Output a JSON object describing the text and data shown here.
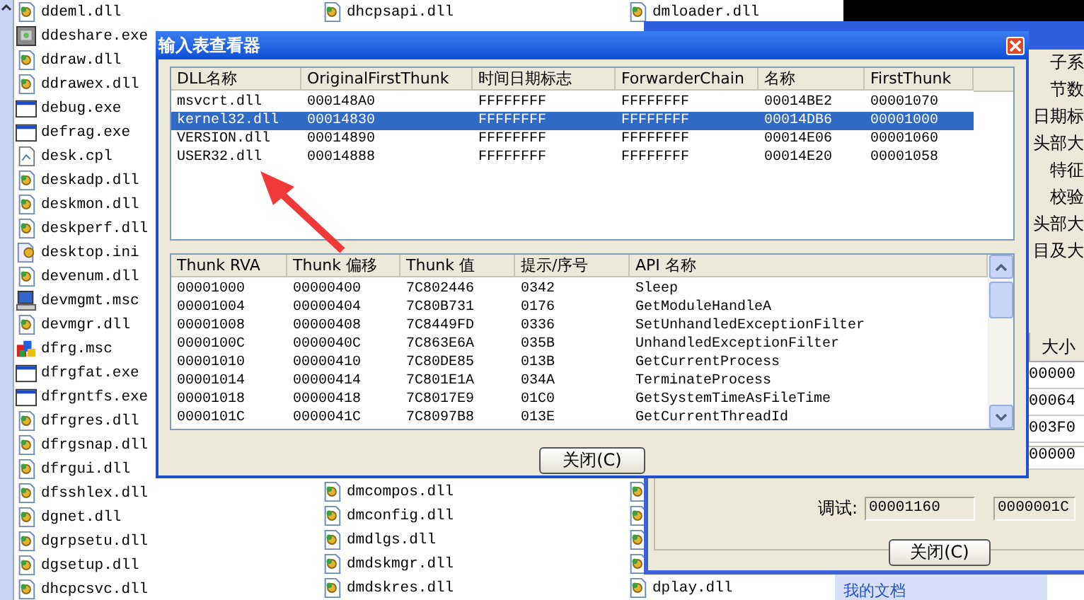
{
  "file_list": {
    "columns": [
      {
        "top_items": [
          {
            "name": "ddeml.dll",
            "kind": "dll"
          },
          {
            "name": "ddeshare.exe",
            "kind": "app"
          },
          {
            "name": "ddraw.dll",
            "kind": "dll"
          },
          {
            "name": "ddrawex.dll",
            "kind": "dll"
          },
          {
            "name": "debug.exe",
            "kind": "window"
          },
          {
            "name": "defrag.exe",
            "kind": "window"
          },
          {
            "name": "desk.cpl",
            "kind": "cpl"
          },
          {
            "name": "deskadp.dll",
            "kind": "dll"
          },
          {
            "name": "deskmon.dll",
            "kind": "dll"
          },
          {
            "name": "deskperf.dll",
            "kind": "dll"
          },
          {
            "name": "desktop.ini",
            "kind": "ini"
          },
          {
            "name": "devenum.dll",
            "kind": "dll"
          },
          {
            "name": "devmgmt.msc",
            "kind": "computer"
          },
          {
            "name": "devmgr.dll",
            "kind": "dll"
          },
          {
            "name": "dfrg.msc",
            "kind": "snapin"
          },
          {
            "name": "dfrgfat.exe",
            "kind": "window"
          },
          {
            "name": "dfrgntfs.exe",
            "kind": "window"
          },
          {
            "name": "dfrgres.dll",
            "kind": "dll"
          },
          {
            "name": "dfrgsnap.dll",
            "kind": "dll"
          },
          {
            "name": "dfrgui.dll",
            "kind": "dll"
          },
          {
            "name": "dfsshlex.dll",
            "kind": "dll"
          },
          {
            "name": "dgnet.dll",
            "kind": "dll"
          },
          {
            "name": "dgrpsetu.dll",
            "kind": "dll"
          },
          {
            "name": "dgsetup.dll",
            "kind": "dll"
          },
          {
            "name": "dhcpcsvc.dll",
            "kind": "dll"
          }
        ]
      },
      {
        "top_items": [
          {
            "name": "dhcpsapi.dll",
            "kind": "dll"
          }
        ],
        "bottom_items": [
          {
            "name": "dmcompos.dll",
            "kind": "dll"
          },
          {
            "name": "dmconfig.dll",
            "kind": "dll"
          },
          {
            "name": "dmdlgs.dll",
            "kind": "dll"
          },
          {
            "name": "dmdskmgr.dll",
            "kind": "dll"
          },
          {
            "name": "dmdskres.dll",
            "kind": "dll"
          }
        ]
      },
      {
        "top_items": [
          {
            "name": "dmloader.dll",
            "kind": "dll"
          }
        ],
        "bottom_items": [
          {
            "kind": "dll"
          },
          {
            "kind": "dll"
          },
          {
            "kind": "dll"
          },
          {
            "kind": "dll"
          },
          {
            "name": "dplay.dll",
            "kind": "dll"
          }
        ]
      }
    ]
  },
  "pe_window": {
    "field_labels": [
      "子系",
      "节数",
      "日期标",
      "头部大",
      "特征",
      "校验",
      "头部大",
      "目及大"
    ],
    "section_table": {
      "column": "大小",
      "values": [
        "00000",
        "00064",
        "003F0",
        "00000"
      ]
    },
    "debug_row": {
      "label": "调试:",
      "values": [
        "00001160",
        "0000001C"
      ]
    },
    "close_button": "关闭(C)"
  },
  "task_pane": {
    "link": "我的文档"
  },
  "dialog": {
    "title": "输入表查看器",
    "dll_table": {
      "columns": [
        "DLL名称",
        "OriginalFirstThunk",
        "时间日期标志",
        "ForwarderChain",
        "名称",
        "FirstThunk"
      ],
      "rows": [
        {
          "cells": [
            "msvcrt.dll",
            "000148A0",
            "FFFFFFFF",
            "FFFFFFFF",
            "00014BE2",
            "00001070"
          ],
          "selected": false
        },
        {
          "cells": [
            "kernel32.dll",
            "00014830",
            "FFFFFFFF",
            "FFFFFFFF",
            "00014DB6",
            "00001000"
          ],
          "selected": true
        },
        {
          "cells": [
            "VERSION.dll",
            "00014890",
            "FFFFFFFF",
            "FFFFFFFF",
            "00014E06",
            "00001060"
          ],
          "selected": false
        },
        {
          "cells": [
            "USER32.dll",
            "00014888",
            "FFFFFFFF",
            "FFFFFFFF",
            "00014E20",
            "00001058"
          ],
          "selected": false
        }
      ]
    },
    "thunk_table": {
      "columns": [
        "Thunk RVA",
        "Thunk 偏移",
        "Thunk 值",
        "提示/序号",
        "API 名称"
      ],
      "rows": [
        [
          "00001000",
          "00000400",
          "7C802446",
          "0342",
          "Sleep"
        ],
        [
          "00001004",
          "00000404",
          "7C80B731",
          "0176",
          "GetModuleHandleA"
        ],
        [
          "00001008",
          "00000408",
          "7C8449FD",
          "0336",
          "SetUnhandledExceptionFilter"
        ],
        [
          "0000100C",
          "0000040C",
          "7C863E6A",
          "035B",
          "UnhandledExceptionFilter"
        ],
        [
          "00001010",
          "00000410",
          "7C80DE85",
          "013B",
          "GetCurrentProcess"
        ],
        [
          "00001014",
          "00000414",
          "7C801E1A",
          "034A",
          "TerminateProcess"
        ],
        [
          "00001018",
          "00000418",
          "7C8017E9",
          "01C0",
          "GetSystemTimeAsFileTime"
        ],
        [
          "0000101C",
          "0000041C",
          "7C8097B8",
          "013E",
          "GetCurrentThreadId"
        ]
      ]
    },
    "close_button": "关闭(C)"
  }
}
